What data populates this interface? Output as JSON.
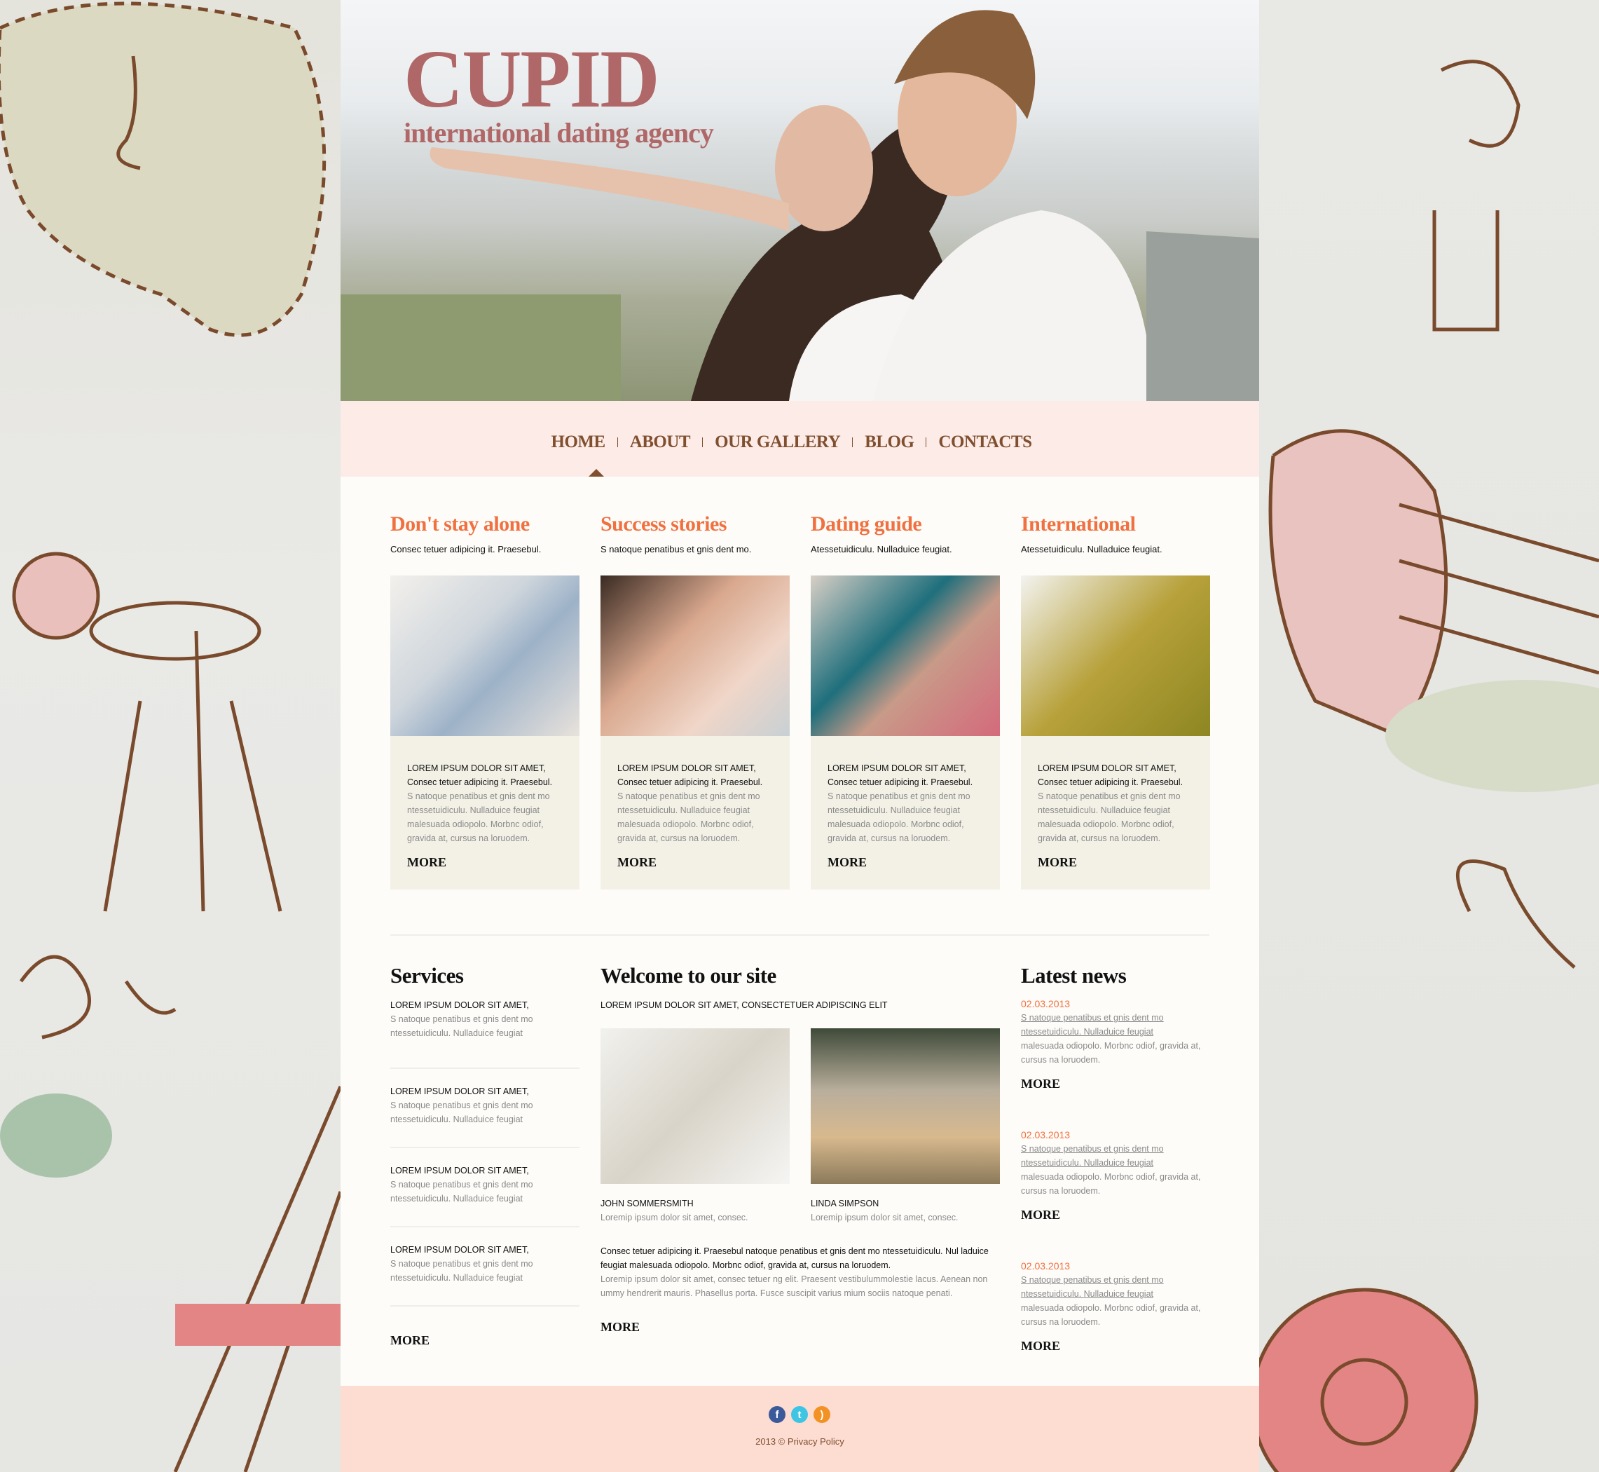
{
  "brand": {
    "title": "CUPID",
    "tagline": "international dating agency",
    "color": "#b06767"
  },
  "nav": {
    "items": [
      {
        "label": "HOME",
        "active": true
      },
      {
        "label": "ABOUT"
      },
      {
        "label": "OUR GALLERY"
      },
      {
        "label": "BLOG"
      },
      {
        "label": "CONTACTS"
      }
    ]
  },
  "features": [
    {
      "title": "Don't stay alone",
      "subtitle": "Consec tetuer adipicing it. Praesebul.",
      "caps": "LOREM IPSUM DOLOR SIT AMET,",
      "lead": "Consec tetuer adipicing it. Praesebul.",
      "body": "S natoque penatibus et gnis dent mo ntessetuidiculu. Nulladuice feugiat malesuada odiopolo. Morbnc odiof, gravida at, cursus na loruodem.",
      "more": "MORE"
    },
    {
      "title": "Success stories",
      "subtitle": "S natoque penatibus et gnis dent mo.",
      "caps": "LOREM IPSUM DOLOR SIT AMET,",
      "lead": "Consec tetuer adipicing it. Praesebul.",
      "body": "S natoque penatibus et gnis dent mo ntessetuidiculu. Nulladuice feugiat malesuada odiopolo. Morbnc odiof, gravida at, cursus na loruodem.",
      "more": "MORE"
    },
    {
      "title": "Dating guide",
      "subtitle": "Atessetuidiculu. Nulladuice feugiat.",
      "caps": "LOREM IPSUM DOLOR SIT AMET,",
      "lead": "Consec tetuer adipicing it. Praesebul.",
      "body": "S natoque penatibus et gnis dent mo ntessetuidiculu. Nulladuice feugiat malesuada odiopolo. Morbnc odiof, gravida at, cursus na loruodem.",
      "more": "MORE"
    },
    {
      "title": "International",
      "subtitle": "Atessetuidiculu. Nulladuice feugiat.",
      "caps": "LOREM IPSUM DOLOR SIT AMET,",
      "lead": "Consec tetuer adipicing it. Praesebul.",
      "body": "S natoque penatibus et gnis dent mo ntessetuidiculu. Nulladuice feugiat malesuada odiopolo. Morbnc odiof, gravida at, cursus na loruodem.",
      "more": "MORE"
    }
  ],
  "services": {
    "title": "Services",
    "items": [
      {
        "caps": "LOREM IPSUM DOLOR SIT AMET,",
        "body": "S natoque penatibus et gnis dent mo ntessetuidiculu. Nulladuice feugiat"
      },
      {
        "caps": "LOREM IPSUM DOLOR SIT AMET,",
        "body": "S natoque penatibus et gnis dent mo ntessetuidiculu. Nulladuice feugiat"
      },
      {
        "caps": "LOREM IPSUM DOLOR SIT AMET,",
        "body": "S natoque penatibus et gnis dent mo ntessetuidiculu. Nulladuice feugiat"
      },
      {
        "caps": "LOREM IPSUM DOLOR SIT AMET,",
        "body": "S natoque penatibus et gnis dent mo ntessetuidiculu. Nulladuice feugiat"
      }
    ],
    "more": "MORE"
  },
  "welcome": {
    "title": "Welcome to our site",
    "caps": "LOREM IPSUM DOLOR SIT AMET, CONSECTETUER ADIPISCING ELIT",
    "people": [
      {
        "name": "JOHN SOMMERSMITH",
        "text": "Loremip ipsum dolor sit amet, consec."
      },
      {
        "name": "LINDA SIMPSON",
        "text": "Loremip ipsum dolor sit amet, consec."
      }
    ],
    "lead": "Consec tetuer adipicing it. Praesebul natoque penatibus et gnis dent mo ntessetuidiculu. Nul laduice feugiat  malesuada odiopolo. Morbnc odiof,  gravida at, cursus na loruodem.",
    "body": "Loremip ipsum dolor sit amet, consec tetuer ng elit. Praesent vestibulummolestie lacus. Aenean non ummy hendrerit mauris. Phasellus porta. Fusce suscipit varius mium sociis natoque penati.",
    "more": "MORE"
  },
  "news": {
    "title": "Latest news",
    "items": [
      {
        "date": "02.03.2013",
        "link": "S natoque penatibus et gnis dent mo ntessetuidiculu. Nulladuice feugiat",
        "body": "malesuada odiopolo. Morbnc odiof, gravida at, cursus na loruodem.",
        "more": "MORE"
      },
      {
        "date": "02.03.2013",
        "link": "S natoque penatibus et gnis dent mo ntessetuidiculu. Nulladuice feugiat",
        "body": "malesuada odiopolo. Morbnc odiof, gravida at, cursus na loruodem.",
        "more": "MORE"
      },
      {
        "date": "02.03.2013",
        "link": "S natoque penatibus et gnis dent mo ntessetuidiculu. Nulladuice feugiat",
        "body": "malesuada odiopolo. Morbnc odiof, gravida at, cursus na loruodem.",
        "more": "MORE"
      }
    ]
  },
  "footer": {
    "social": [
      {
        "icon": "facebook-icon",
        "glyph": "f",
        "color": "#3b5a9a"
      },
      {
        "icon": "twitter-icon",
        "glyph": "t",
        "color": "#3fc5e4"
      },
      {
        "icon": "rss-icon",
        "glyph": ")",
        "color": "#f39224"
      }
    ],
    "copyright": "2013 © Privacy Policy"
  },
  "colors": {
    "accent": "#f1703f",
    "nav": "#7f4f2f",
    "navBg": "#fdebe7",
    "footerBg": "#fddcd2",
    "boxBg": "#f3f1e6"
  }
}
